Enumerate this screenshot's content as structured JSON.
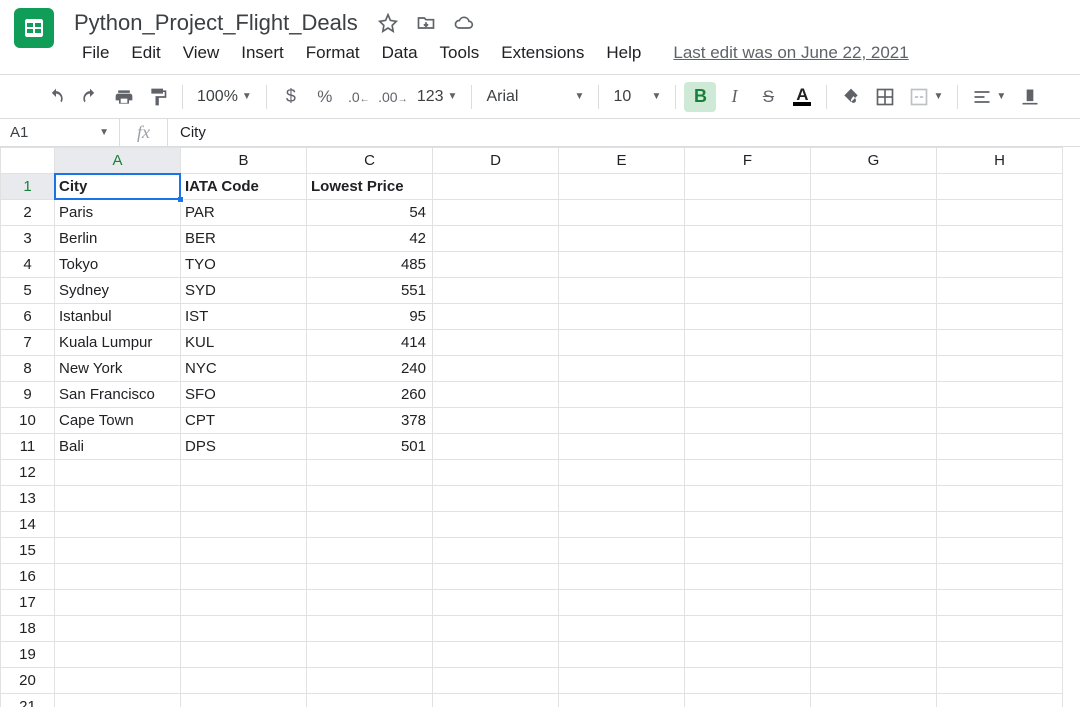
{
  "doc": {
    "title": "Python_Project_Flight_Deals",
    "last_edit": "Last edit was on June 22, 2021"
  },
  "menus": {
    "file": "File",
    "edit": "Edit",
    "view": "View",
    "insert": "Insert",
    "format": "Format",
    "data": "Data",
    "tools": "Tools",
    "extensions": "Extensions",
    "help": "Help"
  },
  "toolbar": {
    "zoom": "100%",
    "font": "Arial",
    "font_size": "10",
    "more_formats": "123"
  },
  "name_box": "A1",
  "fx_label": "fx",
  "formula_value": "City",
  "columns": [
    "A",
    "B",
    "C",
    "D",
    "E",
    "F",
    "G",
    "H"
  ],
  "headers": {
    "A": "City",
    "B": "IATA Code",
    "C": "Lowest Price"
  },
  "rows": [
    {
      "city": "Paris",
      "code": "PAR",
      "price": "54"
    },
    {
      "city": "Berlin",
      "code": "BER",
      "price": "42"
    },
    {
      "city": "Tokyo",
      "code": "TYO",
      "price": "485"
    },
    {
      "city": "Sydney",
      "code": "SYD",
      "price": "551"
    },
    {
      "city": "Istanbul",
      "code": "IST",
      "price": "95"
    },
    {
      "city": "Kuala Lumpur",
      "code": "KUL",
      "price": "414"
    },
    {
      "city": "New York",
      "code": "NYC",
      "price": "240"
    },
    {
      "city": "San Francisco",
      "code": "SFO",
      "price": "260"
    },
    {
      "city": "Cape Town",
      "code": "CPT",
      "price": "378"
    },
    {
      "city": "Bali",
      "code": "DPS",
      "price": "501"
    }
  ],
  "total_visible_rows": 21
}
